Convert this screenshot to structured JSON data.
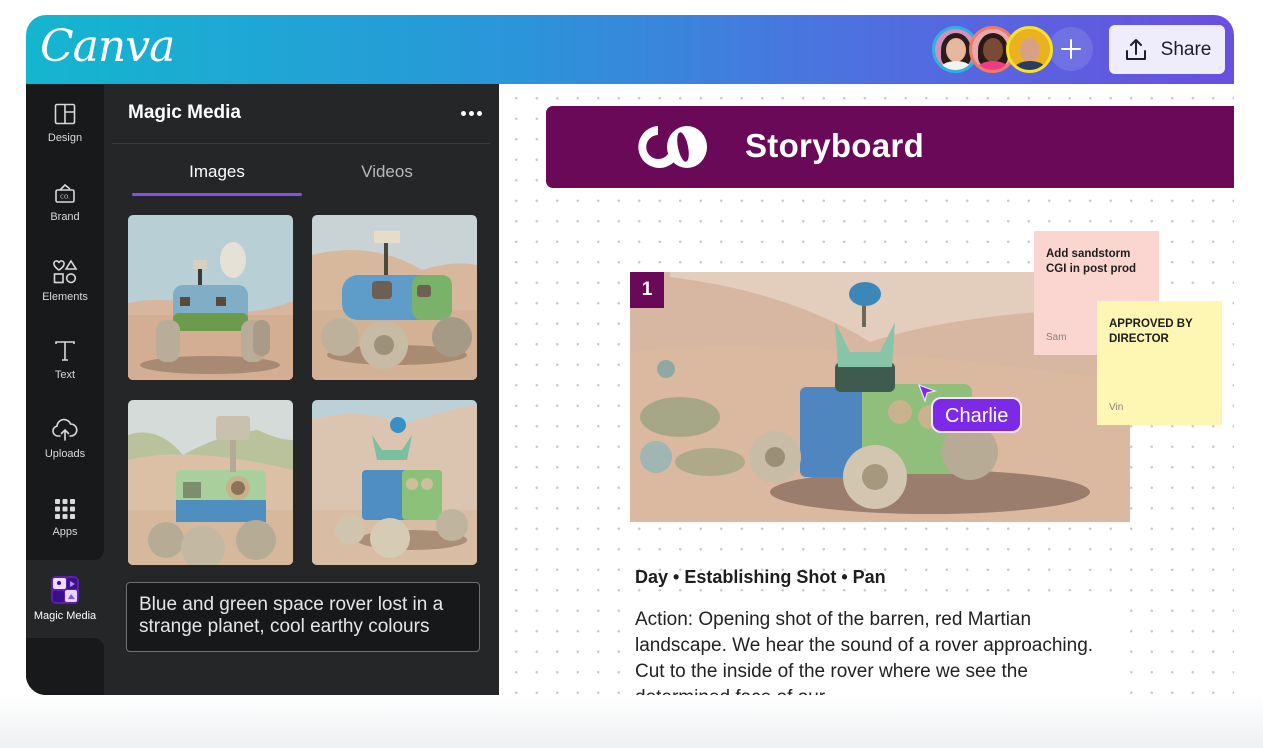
{
  "app": {
    "logo_text": "Canva",
    "share_label": "Share",
    "collaborators": [
      {
        "name": "collaborator-1",
        "ring": "#2bb4e0",
        "bg": "#d58fb9",
        "hair": "#2a1d1a",
        "skin": "#e8b89c",
        "body": "#f3f3f3"
      },
      {
        "name": "collaborator-2",
        "ring": "#f07d63",
        "bg": "#e8a8b2",
        "hair": "#2b1a14",
        "skin": "#7a4a34",
        "body": "#ef3a86"
      },
      {
        "name": "collaborator-3",
        "ring": "#f6e12c",
        "bg": "#eab21f",
        "hair": "#eab21f",
        "skin": "#d9a184",
        "body": "#2c3c5c"
      }
    ]
  },
  "sidebar": {
    "items": [
      {
        "id": "design",
        "label": "Design",
        "icon": "layout-icon"
      },
      {
        "id": "brand",
        "label": "Brand",
        "icon": "brand-kit-icon"
      },
      {
        "id": "elements",
        "label": "Elements",
        "icon": "shapes-icon"
      },
      {
        "id": "text",
        "label": "Text",
        "icon": "text-icon"
      },
      {
        "id": "uploads",
        "label": "Uploads",
        "icon": "cloud-upload-icon"
      },
      {
        "id": "apps",
        "label": "Apps",
        "icon": "grid-icon"
      },
      {
        "id": "magic-media",
        "label": "Magic Media",
        "icon": "magic-media-icon",
        "active": true
      }
    ]
  },
  "panel": {
    "title": "Magic Media",
    "tabs": [
      {
        "label": "Images",
        "active": true
      },
      {
        "label": "Videos",
        "active": false
      }
    ],
    "results": [
      {
        "alt": "Blue and green rover with satellite dish in desert"
      },
      {
        "alt": "Blue rover with periscope camera on dunes"
      },
      {
        "alt": "Green and blue rover with tall camera mast"
      },
      {
        "alt": "Small blue and green rover with antenna"
      }
    ],
    "prompt": "Blue and green space rover lost in a strange planet, cool earthy colours"
  },
  "canvas": {
    "header_title": "Storyboard",
    "brand_color": "#6a0957",
    "scene": {
      "number": "1",
      "image_alt": "Green and blue rover in sandy desert",
      "heading": "Day • Establishing Shot • Pan",
      "body": "Action: Opening shot of the barren, red Martian landscape. We hear the sound of a rover approaching. Cut to the inside of the rover where we see the determined face of our"
    },
    "cursor": {
      "user": "Charlie",
      "color": "#7c2ae8"
    },
    "stickies": [
      {
        "text": "Add sandstorm CGI in post prod",
        "author": "Sam",
        "color": "#fbd6d0"
      },
      {
        "text": "APPROVED BY DIRECTOR",
        "author": "Vin",
        "color": "#fdf7b3"
      }
    ]
  }
}
